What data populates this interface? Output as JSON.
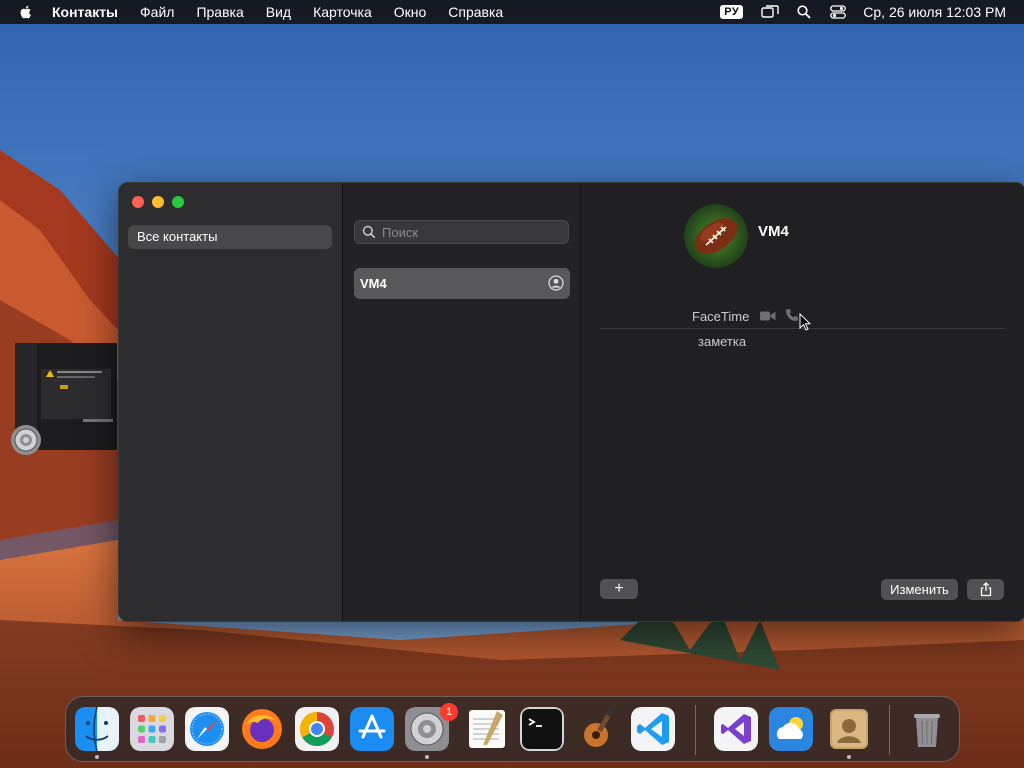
{
  "menubar": {
    "app_name": "Контакты",
    "items": [
      "Файл",
      "Правка",
      "Вид",
      "Карточка",
      "Окно",
      "Справка"
    ],
    "keyboard_layout": "РУ",
    "clock": "Ср, 26 июля  12:03 PM"
  },
  "sidebar": {
    "selected_group": "Все контакты"
  },
  "list": {
    "search_placeholder": "Поиск",
    "contacts": [
      "VM4"
    ]
  },
  "detail": {
    "name": "VM4",
    "facetime_label": "FaceTime",
    "note_label": "заметка",
    "add_button": "+",
    "edit_button": "Изменить"
  },
  "dock": {
    "apps": [
      "finder-icon",
      "launchpad-icon",
      "safari-icon",
      "firefox-icon",
      "chrome-icon",
      "app-store-icon",
      "system-settings-icon",
      "textedit-icon",
      "terminal-icon",
      "instruments-icon",
      "vscode-icon",
      "visual-studio-icon",
      "weather-icon",
      "contacts-icon",
      "trash-icon"
    ],
    "settings_badge": "1"
  },
  "colors": {
    "accent_red": "#fe5f57",
    "accent_yellow": "#febc2e",
    "accent_green": "#28c840",
    "badge_red": "#ff3b30"
  }
}
